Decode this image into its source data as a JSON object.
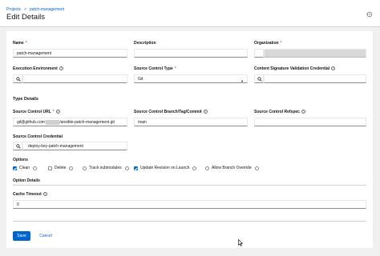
{
  "breadcrumb": {
    "parent": "Projects",
    "separator": ">",
    "current": "patch-management"
  },
  "page_title": "Edit Details",
  "fields": {
    "name": {
      "label": "Name",
      "required": "*",
      "value": "patch-management"
    },
    "description": {
      "label": "Description",
      "value": ""
    },
    "organization": {
      "label": "Organization",
      "required": "*",
      "value": ""
    },
    "execution_environment": {
      "label": "Execution Environment",
      "value": ""
    },
    "source_control_type": {
      "label": "Source Control Type",
      "required": "*",
      "value": "Git"
    },
    "content_signature_credential": {
      "label": "Content Signature Validation Credential",
      "value": ""
    }
  },
  "type_details": {
    "heading": "Type Details",
    "scm_url": {
      "label": "Source Control URL",
      "required": "*",
      "value_prefix": "git@github.com:",
      "value_suffix": "/ansible-patch-management.git"
    },
    "scm_branch": {
      "label": "Source Control Branch/Tag/Commit",
      "value": "main"
    },
    "scm_refspec": {
      "label": "Source Control Refspec",
      "value": ""
    },
    "scm_credential": {
      "label": "Source Control Credential",
      "value": "deploy-key-patch-management"
    }
  },
  "options": {
    "heading": "Options",
    "clean": {
      "label": "Clean",
      "checked": true
    },
    "delete": {
      "label": "Delete",
      "checked": false
    },
    "track_submodules": {
      "label": "Track submodules",
      "checked": false
    },
    "update_on_launch": {
      "label": "Update Revision on Launch",
      "checked": true
    },
    "allow_override": {
      "label": "Allow Branch Override",
      "checked": false
    }
  },
  "option_details": {
    "heading": "Option Details",
    "cache_timeout": {
      "label": "Cache Timeout",
      "value": "0"
    }
  },
  "actions": {
    "save_label": "Save",
    "cancel_label": "Cancel"
  },
  "colors": {
    "accent": "#0066cc",
    "required": "#c9190b"
  },
  "icons": {
    "history": "history-icon",
    "search": "search-icon",
    "help": "help-icon",
    "caret": "caret-down-icon"
  }
}
